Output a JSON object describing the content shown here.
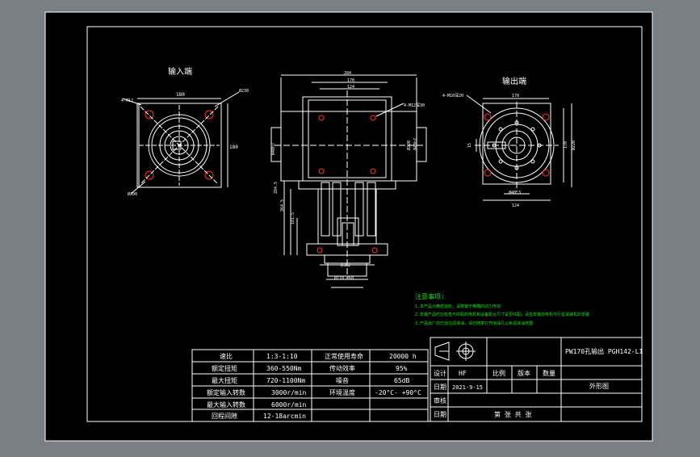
{
  "views": {
    "input_label": "输入端",
    "output_label": "输出端",
    "input_dims": {
      "top": "180",
      "right": "180",
      "tl_note": "4-M12",
      "tr_note": "Ø230",
      "bl_note": "Ø200"
    },
    "side_dims": {
      "overall": "284",
      "mid": "170",
      "inner": "124",
      "hole_note": "4-M12深30",
      "right_a": "Ø220",
      "right_b": "Ø40h7",
      "left_a": "Ø40h7",
      "v1": "284.5",
      "v2": "364.5",
      "v3": "181.5",
      "b1": "Ø382",
      "b2": "Ø110.268"
    },
    "output_dims": {
      "top": "170",
      "left_note": "4-M10深20",
      "bottom_a": "Ø40.3",
      "bottom_b": "124",
      "right_a": "170",
      "right_b": "Ø220",
      "left_side": "15"
    }
  },
  "notes": {
    "title": "注意事项:",
    "items": [
      "1.本产品为精密齿轮，请按装于精确的动力传动",
      "2.安装产品时应检查与匹配的电机和设备配合尺寸是否匹配，请在安装前电机与行星减速机的安装",
      "3.产品出厂前已加注润滑油，请勿随意打开加油孔以免润滑油泄露"
    ]
  },
  "spec_table": {
    "rows": [
      [
        "速比",
        "1:3-1:10",
        "正常使用寿命",
        "20000 h"
      ],
      [
        "额定扭矩",
        "360-550Nm",
        "传动效率",
        "95%"
      ],
      [
        "最大扭矩",
        "720-1100Nm",
        "噪音",
        "65dB"
      ],
      [
        "额定输入转数",
        "3000r/min",
        "环境温度",
        "-20°C- +90°C"
      ],
      [
        "最大输入转数",
        "6000r/min",
        "",
        ""
      ],
      [
        "回程间隙",
        "12-18arcmin",
        "",
        ""
      ]
    ]
  },
  "title_block": {
    "product": "PW170孔输出 PGH142-L1",
    "drawing_name": "外形图",
    "design_label": "设计",
    "designer": "HF",
    "date_label": "日期",
    "date": "2021-9-15",
    "scale_label": "比例",
    "version_label": "版本",
    "qty_label": "数量",
    "review_label": "审核",
    "date2_label": "日期",
    "sheet_label": "第  张  共  张"
  },
  "colors": {
    "background": "#000000",
    "line": "#ffffff",
    "hole": "#ff3030",
    "note": "#22dd22",
    "outer": "#7a7f86"
  }
}
